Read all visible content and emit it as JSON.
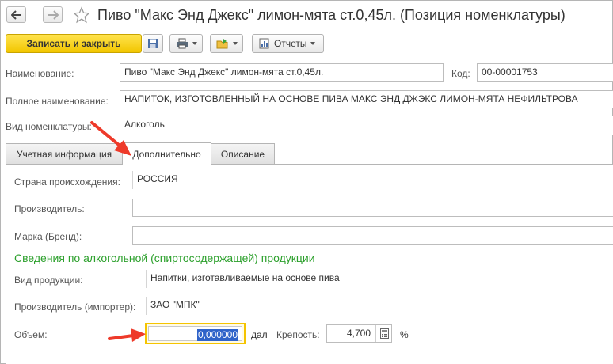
{
  "window": {
    "title": "Пиво \"Макс Энд Джекс\" лимон-мята ст.0,45л. (Позиция номенклатуры)"
  },
  "icons": {
    "back": "arrow-left-icon",
    "forward": "arrow-right-icon",
    "favorite": "star-icon",
    "save": "floppy-disk-icon",
    "print": "printer-icon",
    "create_based_on": "folder-create-icon",
    "reports": "reports-icon",
    "calculator": "calculator-icon"
  },
  "toolbar": {
    "save_close_label": "Записать и закрыть",
    "reports_label": "Отчеты"
  },
  "header_fields": {
    "name_label": "Наименование:",
    "name_value": "Пиво \"Макс Энд Джекс\" лимон-мята ст.0,45л.",
    "code_label": "Код:",
    "code_value": "00-00001753",
    "full_name_label": "Полное наименование:",
    "full_name_value": "НАПИТОК, ИЗГОТОВЛЕННЫЙ НА ОСНОВЕ ПИВА МАКС ЭНД ДЖЭКС ЛИМОН-МЯТА НЕФИЛЬТРОВА",
    "kind_label": "Вид номенклатуры:",
    "kind_value": "Алкоголь"
  },
  "tabs": [
    {
      "label": "Учетная информация",
      "active": false
    },
    {
      "label": "Дополнительно",
      "active": true
    },
    {
      "label": "Описание",
      "active": false
    }
  ],
  "additional": {
    "country_label": "Страна происхождения:",
    "country_value": "РОССИЯ",
    "manufacturer_label": "Производитель:",
    "manufacturer_value": "",
    "brand_label": "Марка (Бренд):",
    "brand_value": "",
    "section_title": "Сведения по алкогольной (спиртосодержащей) продукции",
    "product_kind_label": "Вид продукции:",
    "product_kind_value": "Напитки, изготавливаемые на основе пива",
    "importer_label": "Производитель (импортер):",
    "importer_value": "ЗАО \"МПК\"",
    "volume_label": "Объем:",
    "volume_value": "0,000000",
    "volume_unit": "дал",
    "strength_label": "Крепость:",
    "strength_value": "4,700",
    "strength_unit": "%"
  },
  "colors": {
    "primary_button": "#f5cc00",
    "section_title": "#2ca02c",
    "highlight_border": "#f5c400",
    "annotation_arrow": "#ee3a2a",
    "selection": "#2f63c9"
  }
}
